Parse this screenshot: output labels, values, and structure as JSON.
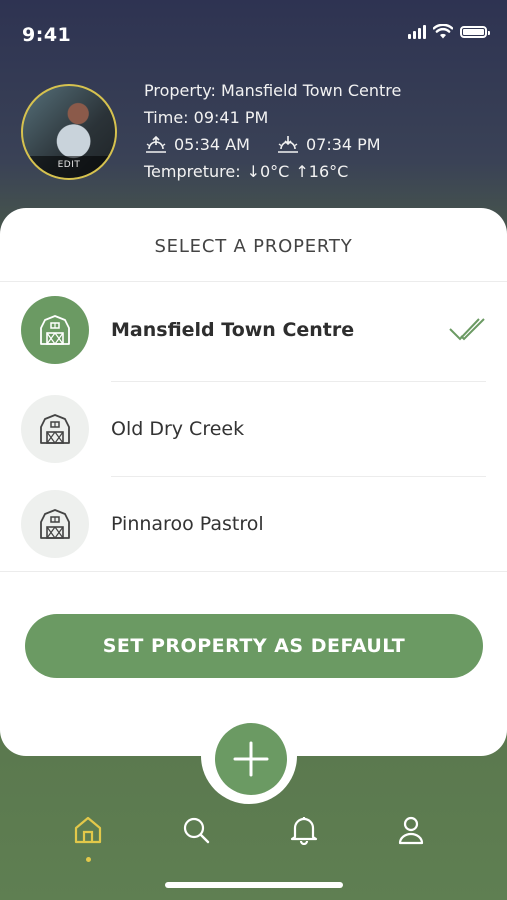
{
  "status_bar": {
    "time": "9:41"
  },
  "header": {
    "avatar_label": "EDIT",
    "property_line": "Property: Mansfield Town Centre",
    "time_line": "Time: 09:41 PM",
    "sunrise": "05:34 AM",
    "sunset": "07:34 PM",
    "temperature_label": "Tempreture:",
    "temp_min": "↓0°C",
    "temp_max": "↑16°C"
  },
  "selector": {
    "title": "SELECT A PROPERTY",
    "properties": [
      {
        "name": "Mansfield Town Centre",
        "selected": true
      },
      {
        "name": "Old Dry Creek",
        "selected": false
      },
      {
        "name": "Pinnaroo Pastrol",
        "selected": false
      }
    ],
    "cta_label": "SET PROPERTY AS DEFAULT"
  },
  "tabbar": {
    "items": [
      {
        "icon": "home-icon",
        "active": true
      },
      {
        "icon": "search-icon",
        "active": false
      },
      {
        "icon": "bell-icon",
        "active": false
      },
      {
        "icon": "user-icon",
        "active": false
      }
    ],
    "fab_icon": "plus-icon"
  },
  "colors": {
    "accent": "#6b9a63",
    "avatar_ring": "#d6c24f",
    "active_tab": "#e2c84a"
  }
}
